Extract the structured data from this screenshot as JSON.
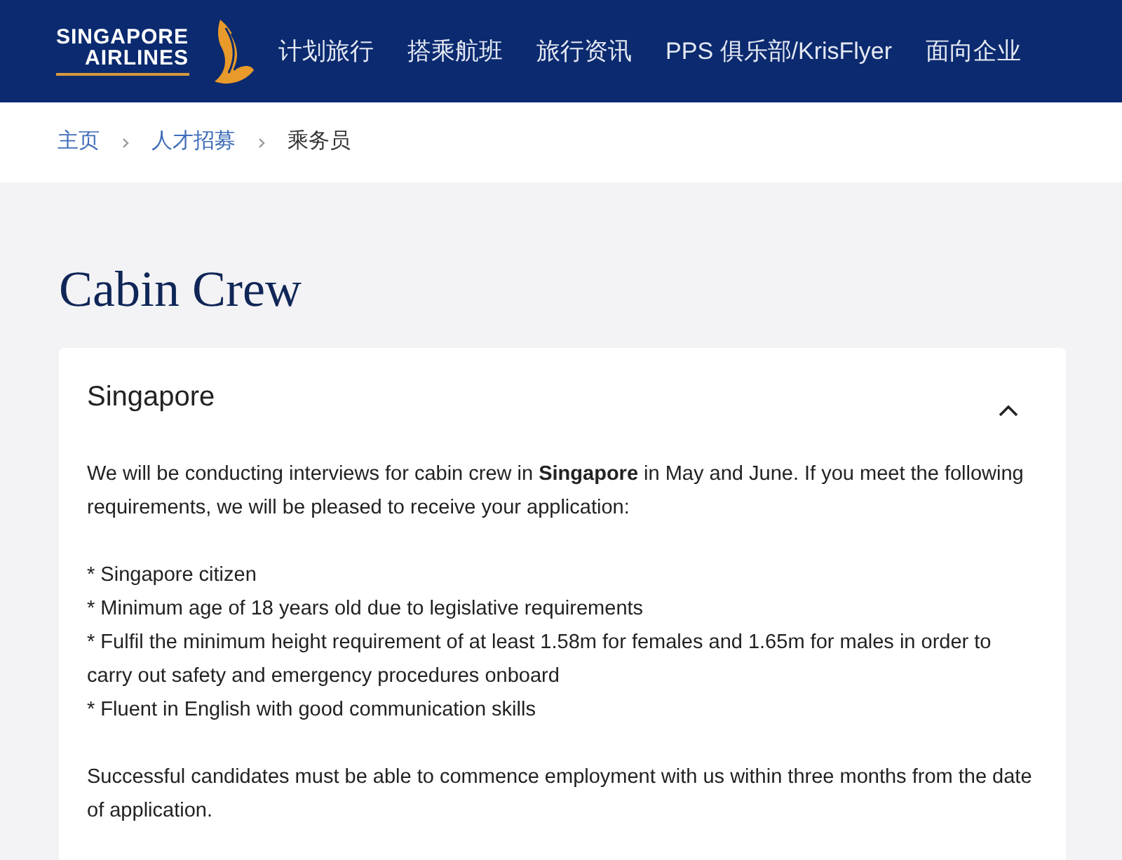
{
  "header": {
    "logo": [
      "SINGAPORE",
      "AIRLINES"
    ],
    "nav": [
      "计划旅行",
      "搭乘航班",
      "旅行资讯",
      "PPS 俱乐部/KrisFlyer",
      "面向企业"
    ]
  },
  "breadcrumb": [
    {
      "label": "主页",
      "current": false
    },
    {
      "label": "人才招募",
      "current": false
    },
    {
      "label": "乘务员",
      "current": true
    }
  ],
  "title": "Cabin Crew",
  "accordion": {
    "title": "Singapore",
    "expanded": true,
    "intro": "We will be conducting interviews for cabin crew in **Singapore** in May and June. If you meet the following requirements, we will be pleased to receive your application:",
    "requirements": [
      "* Singapore citizen",
      "* Minimum age of 18 years old due to legislative requirements",
      "* Fulfil the minimum height requirement of at least 1.58m for females and 1.65m for males in order to carry out safety and emergency procedures onboard",
      "* Fluent in English with good communication skills"
    ],
    "closing": "Successful candidates must be able to commence employment with us within three months from the date of application."
  }
}
